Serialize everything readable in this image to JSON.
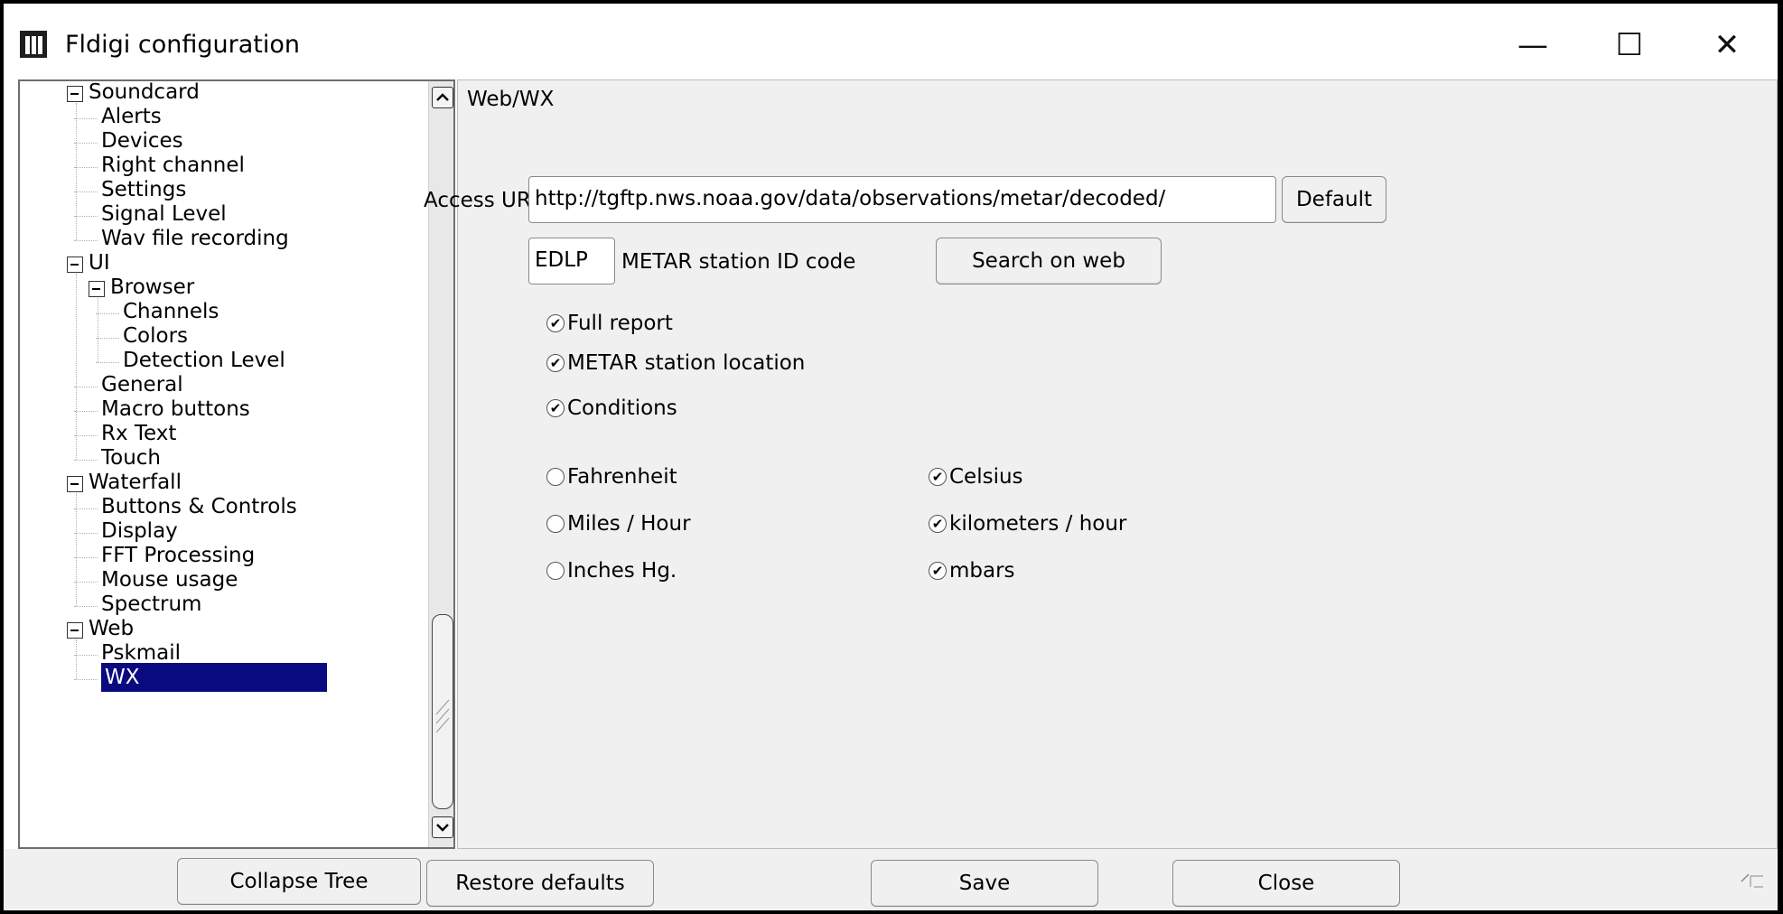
{
  "window": {
    "title": "Fldigi configuration",
    "controls": {
      "minimize": "—",
      "maximize": "☐",
      "close": "✕"
    }
  },
  "tree": {
    "items": [
      {
        "label": "Soundcard",
        "level": 0,
        "expandable": true
      },
      {
        "label": "Alerts",
        "level": 1
      },
      {
        "label": "Devices",
        "level": 1
      },
      {
        "label": "Right channel",
        "level": 1
      },
      {
        "label": "Settings",
        "level": 1
      },
      {
        "label": "Signal Level",
        "level": 1
      },
      {
        "label": "Wav file recording",
        "level": 1
      },
      {
        "label": "UI",
        "level": 0,
        "expandable": true
      },
      {
        "label": "Browser",
        "level": 1,
        "expandable": true
      },
      {
        "label": "Channels",
        "level": 2
      },
      {
        "label": "Colors",
        "level": 2
      },
      {
        "label": "Detection Level",
        "level": 2
      },
      {
        "label": "General",
        "level": 1
      },
      {
        "label": "Macro buttons",
        "level": 1
      },
      {
        "label": "Rx Text",
        "level": 1
      },
      {
        "label": "Touch",
        "level": 1
      },
      {
        "label": "Waterfall",
        "level": 0,
        "expandable": true
      },
      {
        "label": "Buttons & Controls",
        "level": 1
      },
      {
        "label": "Display",
        "level": 1
      },
      {
        "label": "FFT Processing",
        "level": 1
      },
      {
        "label": "Mouse usage",
        "level": 1
      },
      {
        "label": "Spectrum",
        "level": 1
      },
      {
        "label": "Web",
        "level": 0,
        "expandable": true
      },
      {
        "label": "Pskmail",
        "level": 1
      },
      {
        "label": "WX",
        "level": 1,
        "selected": true
      }
    ],
    "selected_color": "#0a0a80"
  },
  "scrollbar": {
    "up_icon": "arrow-up-icon",
    "down_icon": "arrow-down-icon"
  },
  "content": {
    "section_title": "Web/WX",
    "access_url_label": "Access URL",
    "access_url_value": "http://tgftp.nws.noaa.gov/data/observations/metar/decoded/",
    "default_button": "Default",
    "station_id_value": "EDLP",
    "station_id_label": "METAR station ID code",
    "search_button": "Search on  web",
    "checkboxes": {
      "full_report": {
        "label": "Full report",
        "checked": true
      },
      "station_location": {
        "label": "METAR station location",
        "checked": true
      },
      "conditions": {
        "label": "Conditions",
        "checked": true
      },
      "fahrenheit": {
        "label": "Fahrenheit",
        "checked": false
      },
      "celsius": {
        "label": "Celsius",
        "checked": true
      },
      "miles_hour": {
        "label": "Miles / Hour",
        "checked": false
      },
      "km_hour": {
        "label": "kilometers / hour",
        "checked": true
      },
      "inches_hg": {
        "label": "Inches Hg.",
        "checked": false
      },
      "mbars": {
        "label": "mbars",
        "checked": true
      }
    }
  },
  "bottom": {
    "collapse_tree": "Collapse Tree",
    "restore_defaults": "Restore defaults",
    "save": "Save",
    "close": "Close"
  }
}
